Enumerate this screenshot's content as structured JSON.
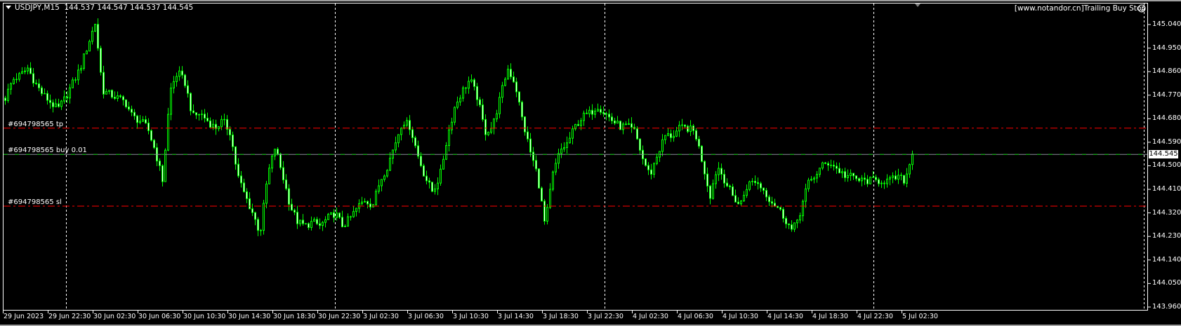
{
  "window": {
    "symbol_timeframe": "USDJPY,M15",
    "ohlc": "144.537 144.547 144.537 144.545",
    "expert_label": "[www.notandor.cn]Trailing Buy Stop",
    "expert_icon": "smiley-face-icon"
  },
  "orders": {
    "tp_label": "#694798565 tp",
    "buy_label": "#694798565 buy 0.01",
    "sl_label": "#694798565 sl",
    "tp_price": 144.644,
    "entry_price": 144.545,
    "sl_price": 144.346,
    "tp_sl_color": "#ff0000",
    "entry_color": "#00c000"
  },
  "colors": {
    "background": "#000000",
    "candle": "#00ff00",
    "bull_fill": "#000000",
    "bear_fill": "#ffffff",
    "grid": "#ffffff"
  },
  "chart_data": {
    "type": "candlestick",
    "symbol": "USDJPY",
    "timeframe": "M15",
    "ylim": [
      143.96,
      145.04
    ],
    "y_ticks": [
      "145.040",
      "144.950",
      "144.860",
      "144.770",
      "144.680",
      "144.590",
      "144.500",
      "144.410",
      "144.320",
      "144.230",
      "144.140",
      "144.050",
      "143.960"
    ],
    "current_price": "144.545",
    "x_ticks": [
      "29 Jun 2023",
      "29 Jun 22:30",
      "30 Jun 02:30",
      "30 Jun 06:30",
      "30 Jun 10:30",
      "30 Jun 14:30",
      "30 Jun 18:30",
      "30 Jun 22:30",
      "3 Jul 02:30",
      "3 Jul 06:30",
      "3 Jul 10:30",
      "3 Jul 14:30",
      "3 Jul 18:30",
      "3 Jul 22:30",
      "4 Jul 02:30",
      "4 Jul 06:30",
      "4 Jul 10:30",
      "4 Jul 14:30",
      "4 Jul 18:30",
      "4 Jul 22:30",
      "5 Jul 02:30"
    ],
    "grid": "day separators only",
    "approx_close_path": [
      144.759,
      144.83,
      144.845,
      144.873,
      144.816,
      144.773,
      144.744,
      144.715,
      144.759,
      144.816,
      144.873,
      144.96,
      145.046,
      144.787,
      144.773,
      144.759,
      144.744,
      144.687,
      144.672,
      144.644,
      144.557,
      144.443,
      144.787,
      144.859,
      144.816,
      144.687,
      144.701,
      144.672,
      144.644,
      144.672,
      144.629,
      144.463,
      144.385,
      144.32,
      144.24,
      144.463,
      144.572,
      144.463,
      144.348,
      144.285,
      144.27,
      144.285,
      144.27,
      144.299,
      144.32,
      144.27,
      144.299,
      144.342,
      144.371,
      144.348,
      144.443,
      144.5,
      144.586,
      144.672,
      144.65,
      144.543,
      144.457,
      144.4,
      144.463,
      144.615,
      144.73,
      144.787,
      144.83,
      144.759,
      144.629,
      144.65,
      144.759,
      144.873,
      144.816,
      144.672,
      144.557,
      144.463,
      144.27,
      144.463,
      144.557,
      144.586,
      144.65,
      144.687,
      144.701,
      144.73,
      144.701,
      144.672,
      144.65,
      144.65,
      144.629,
      144.529,
      144.463,
      144.543,
      144.615,
      144.615,
      144.644,
      144.644,
      144.629,
      144.514,
      144.385,
      144.5,
      144.443,
      144.385,
      144.348,
      144.428,
      144.443,
      144.414,
      144.371,
      144.342,
      144.299,
      144.248,
      144.32,
      144.428,
      144.463,
      144.5,
      144.514,
      144.486,
      144.463,
      144.457,
      144.443,
      144.443,
      144.443,
      144.443,
      144.443,
      144.457,
      144.443,
      144.545
    ]
  }
}
